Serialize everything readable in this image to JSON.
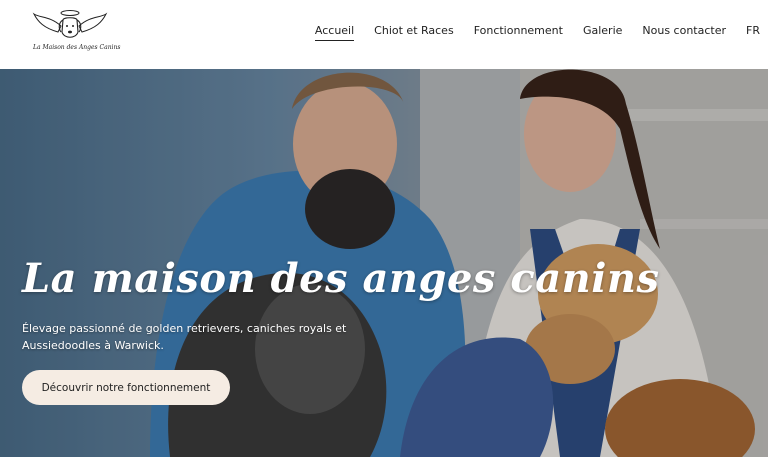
{
  "logo": {
    "text": "La Maison des Anges Canins",
    "icon": "angel-dog-logo-icon"
  },
  "nav": {
    "items": [
      {
        "label": "Accueil",
        "active": true
      },
      {
        "label": "Chiot et Races"
      },
      {
        "label": "Fonctionnement"
      },
      {
        "label": "Galerie"
      },
      {
        "label": "Nous contacter"
      },
      {
        "label": "FR"
      }
    ]
  },
  "hero": {
    "title": "La maison des anges canins",
    "subtitle": "Élevage passionné de golden retrievers, caniches royals et Aussiedoodles à Warwick.",
    "cta_label": "Découvrir notre fonctionnement"
  },
  "colors": {
    "header_bg": "#ffffff",
    "cta_bg": "#f5ece3",
    "text_light": "#ffffff",
    "text_dark": "#222222"
  }
}
